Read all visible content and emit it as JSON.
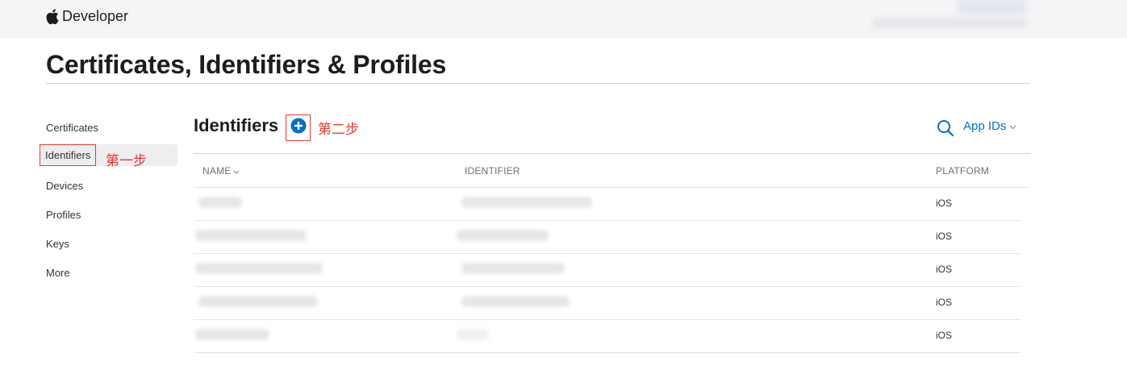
{
  "header": {
    "brand": "Developer",
    "logo_icon": "apple-logo-icon"
  },
  "page": {
    "title": "Certificates, Identifiers & Profiles"
  },
  "sidebar": {
    "items": [
      {
        "label": "Certificates",
        "active": false
      },
      {
        "label": "Identifiers",
        "active": true
      },
      {
        "label": "Devices",
        "active": false
      },
      {
        "label": "Profiles",
        "active": false
      },
      {
        "label": "Keys",
        "active": false
      },
      {
        "label": "More",
        "active": false
      }
    ]
  },
  "annotations": {
    "step1": "第一步",
    "step2": "第二步",
    "color": "#e53935"
  },
  "main": {
    "title": "Identifiers",
    "add_icon": "plus-circle-icon",
    "search_icon": "search-icon",
    "filter": {
      "label": "App IDs",
      "icon": "chevron-down-icon"
    }
  },
  "table": {
    "columns": {
      "name": "NAME",
      "identifier": "IDENTIFIER",
      "platform": "PLATFORM"
    },
    "rows": [
      {
        "name": "",
        "identifier": "",
        "platform": "iOS"
      },
      {
        "name": "",
        "identifier": "",
        "platform": "iOS"
      },
      {
        "name": "",
        "identifier": "",
        "platform": "iOS"
      },
      {
        "name": "",
        "identifier": "",
        "platform": "iOS"
      },
      {
        "name": "",
        "identifier": "",
        "platform": "iOS"
      }
    ]
  },
  "colors": {
    "accent": "#0070c9",
    "topbar": "#f5f5f7",
    "active_item": "#eeeeee"
  }
}
